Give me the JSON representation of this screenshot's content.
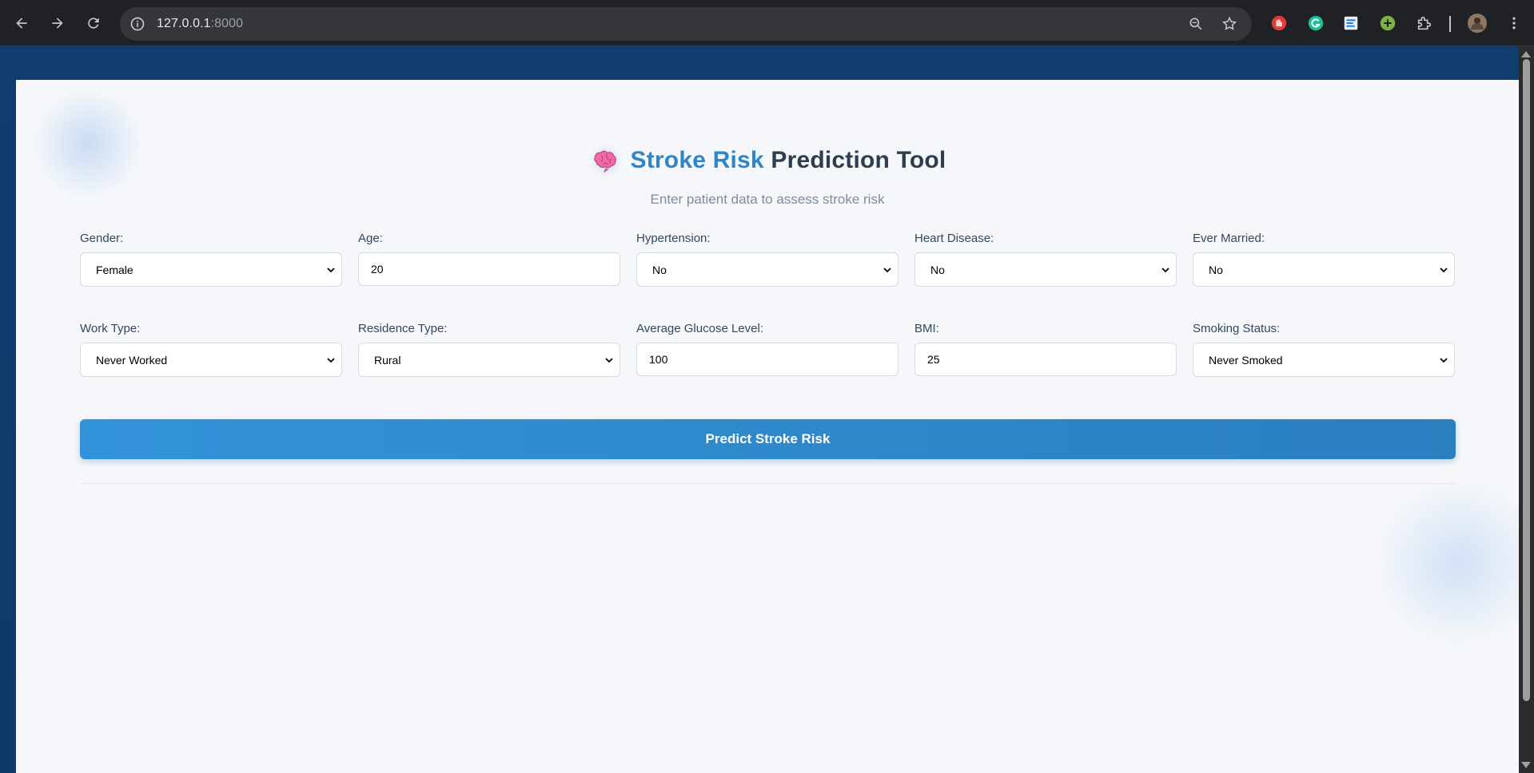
{
  "browser": {
    "url_host": "127.0.0.1",
    "url_port": ":8000"
  },
  "page": {
    "title_accent": "Stroke Risk",
    "title_rest": "Prediction Tool",
    "subtitle": "Enter patient data to assess stroke risk",
    "predict_label": "Predict Stroke Risk"
  },
  "fields": [
    {
      "label": "Gender:",
      "value": "Female",
      "kind": "select"
    },
    {
      "label": "Age:",
      "value": "20",
      "kind": "input"
    },
    {
      "label": "Hypertension:",
      "value": "No",
      "kind": "select"
    },
    {
      "label": "Heart Disease:",
      "value": "No",
      "kind": "select"
    },
    {
      "label": "Ever Married:",
      "value": "No",
      "kind": "select"
    },
    {
      "label": "Work Type:",
      "value": "Never Worked",
      "kind": "select"
    },
    {
      "label": "Residence Type:",
      "value": "Rural",
      "kind": "select"
    },
    {
      "label": "Average Glucose Level:",
      "value": "100",
      "kind": "input"
    },
    {
      "label": "BMI:",
      "value": "25",
      "kind": "input"
    },
    {
      "label": "Smoking Status:",
      "value": "Never Smoked",
      "kind": "select"
    }
  ],
  "colors": {
    "accent": "#2e86c9",
    "title": "#2c3e50",
    "button": "#3393d8"
  }
}
